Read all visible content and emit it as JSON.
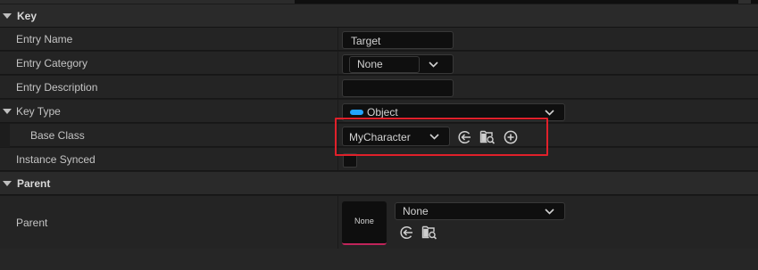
{
  "sections": {
    "key": "Key",
    "parent": "Parent"
  },
  "rows": {
    "entry_name": {
      "label": "Entry Name",
      "value": "Target"
    },
    "entry_category": {
      "label": "Entry Category",
      "value": "None"
    },
    "entry_description": {
      "label": "Entry Description",
      "value": ""
    },
    "key_type": {
      "label": "Key Type",
      "value": "Object",
      "pill_color": "#22a3ff"
    },
    "base_class": {
      "label": "Base Class",
      "value": "MyCharacter"
    },
    "instance_synced": {
      "label": "Instance Synced",
      "checked": false
    },
    "parent": {
      "label": "Parent",
      "thumbnail_text": "None",
      "value": "None"
    }
  },
  "icons": {
    "use_selected": "arrow-left-circle-icon",
    "browse": "folder-search-icon",
    "add": "plus-circle-icon",
    "expand": "triangle-down-icon",
    "dropdown": "chevron-down-icon"
  },
  "colors": {
    "highlight": "#e0202a",
    "object_pill": "#22a3ff",
    "thumbnail_accent": "#c0245a"
  }
}
